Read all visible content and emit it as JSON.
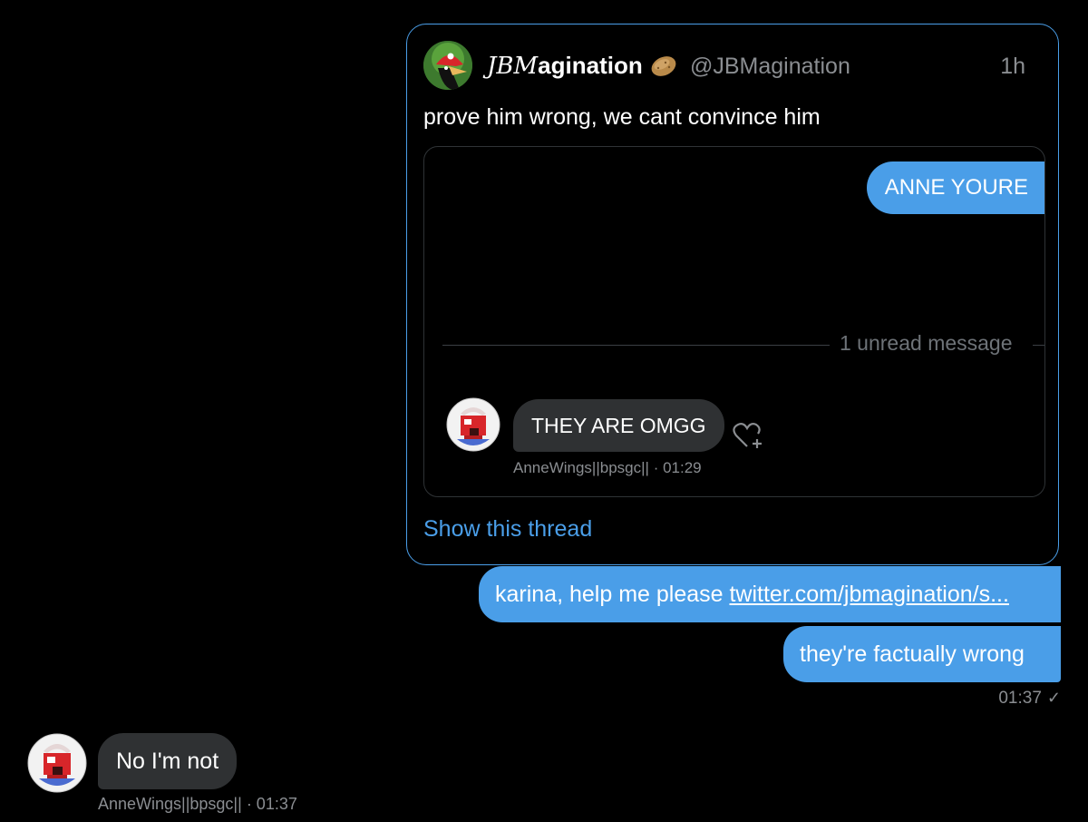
{
  "quoted_tweet": {
    "author_name_styled": "JBM",
    "author_name_rest": "agination",
    "emoji_icon": "potato-emoji",
    "handle": "@JBMagination",
    "time": "1h",
    "text": "prove him wrong, we cant convince him",
    "embedded_chat": {
      "outgoing_message": "ANNE YOURE",
      "unread_label": "1 unread message",
      "incoming_message": "THEY ARE OMGG",
      "incoming_sender": "AnneWings||bpsgc||",
      "incoming_time": "· 01:29"
    },
    "show_thread_label": "Show this thread"
  },
  "messages": {
    "outgoing_1_text": "karina, help me please ",
    "outgoing_1_link": "twitter.com/jbmagination/s...",
    "outgoing_2_text": "they're factually wrong",
    "outgoing_time": "01:37",
    "incoming_text": "No I'm not",
    "incoming_sender": "AnneWings||bpsgc||",
    "incoming_time": "· 01:37"
  },
  "colors": {
    "accent": "#4a9ee8",
    "incoming_bubble": "#2f3133",
    "background": "#000000",
    "muted_text": "#8a8d91"
  }
}
